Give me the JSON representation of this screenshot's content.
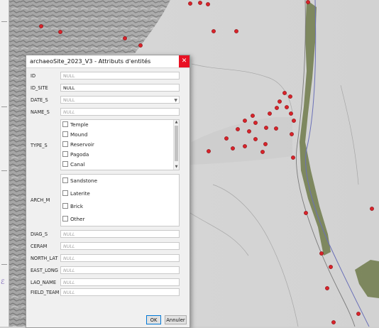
{
  "dialog": {
    "title": "archaeoSite_2023_V3 - Attributs d'entités",
    "close_glyph": "✕",
    "fields": [
      {
        "label": "ID",
        "value": "NULL",
        "style": "plain"
      },
      {
        "label": "ID_SITE",
        "value": "NULL",
        "style": "filled"
      },
      {
        "label": "DATE_S",
        "value": "NULL",
        "style": "plain"
      },
      {
        "label": "NAME_S",
        "value": "NULL",
        "style": "italic"
      }
    ],
    "type_s": {
      "label": "TYPE_S",
      "options": [
        "Temple",
        "Mound",
        "Reservoir",
        "Pagoda",
        "Canal"
      ]
    },
    "arch_m": {
      "label": "ARCH_M",
      "options": [
        "Sandstone",
        "Laterite",
        "Brick",
        "Other"
      ]
    },
    "bottom_fields": [
      {
        "label": "DIAG_S",
        "value": "NULL"
      },
      {
        "label": "CERAM",
        "value": "NULL"
      },
      {
        "label": "NORTH_LAT",
        "value": "NULL"
      },
      {
        "label": "EAST_LONG",
        "value": "NULL"
      },
      {
        "label": "LAO_NAME",
        "value": "NULL"
      },
      {
        "label": "FIELD_TEAM",
        "value": "NULL"
      }
    ],
    "ok_label": "OK",
    "cancel_label": "Annuler"
  },
  "map": {
    "point_color": "#d8232a",
    "hillshade_color": "#8a8a8a",
    "vegetation_color": "#6f7a4a",
    "line_color": "#6a70b8"
  },
  "left_panel": {
    "symbol": "ℰ"
  }
}
